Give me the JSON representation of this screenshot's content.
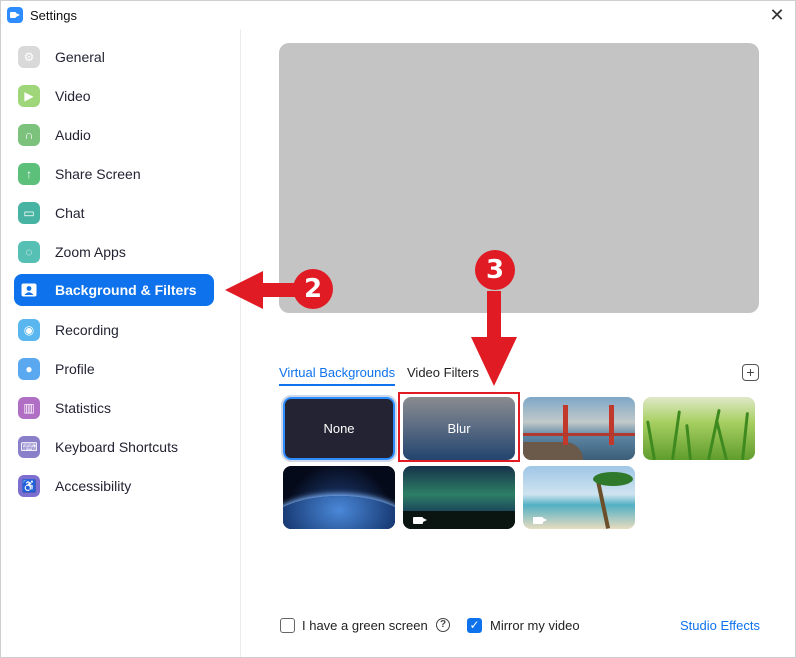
{
  "window": {
    "title": "Settings",
    "close": "✕"
  },
  "sidebar": {
    "items": [
      {
        "label": "General",
        "icon": "gear-icon",
        "color": "#d9d9d9"
      },
      {
        "label": "Video",
        "icon": "video-camera-icon",
        "color": "#9fd67a"
      },
      {
        "label": "Audio",
        "icon": "headphones-icon",
        "color": "#7cc27c"
      },
      {
        "label": "Share Screen",
        "icon": "share-screen-icon",
        "color": "#5cbf7a"
      },
      {
        "label": "Chat",
        "icon": "chat-bubble-icon",
        "color": "#47b3a2"
      },
      {
        "label": "Zoom Apps",
        "icon": "apps-icon",
        "color": "#56c0b5"
      },
      {
        "label": "Background & Filters",
        "icon": "person-card-icon",
        "color": "#0e72ed",
        "active": true
      },
      {
        "label": "Recording",
        "icon": "record-icon",
        "color": "#59b6ef"
      },
      {
        "label": "Profile",
        "icon": "profile-icon",
        "color": "#5aa8ef"
      },
      {
        "label": "Statistics",
        "icon": "bar-chart-icon",
        "color": "#b06fc4"
      },
      {
        "label": "Keyboard Shortcuts",
        "icon": "keyboard-icon",
        "color": "#8a7fc9"
      },
      {
        "label": "Accessibility",
        "icon": "accessibility-icon",
        "color": "#7d6fcf"
      }
    ]
  },
  "tabs": {
    "virtual": "Virtual Backgrounds",
    "filters": "Video Filters",
    "add": "+"
  },
  "backgrounds": {
    "none": "None",
    "blur": "Blur"
  },
  "options": {
    "green_screen": "I have a green screen",
    "help": "?",
    "mirror": "Mirror my video",
    "mirror_check": "✓",
    "studio_effects": "Studio Effects"
  },
  "annotations": {
    "step2": "2",
    "step3": "3"
  },
  "colors": {
    "accent": "#0e72ed",
    "annotation": "#e01b24"
  }
}
